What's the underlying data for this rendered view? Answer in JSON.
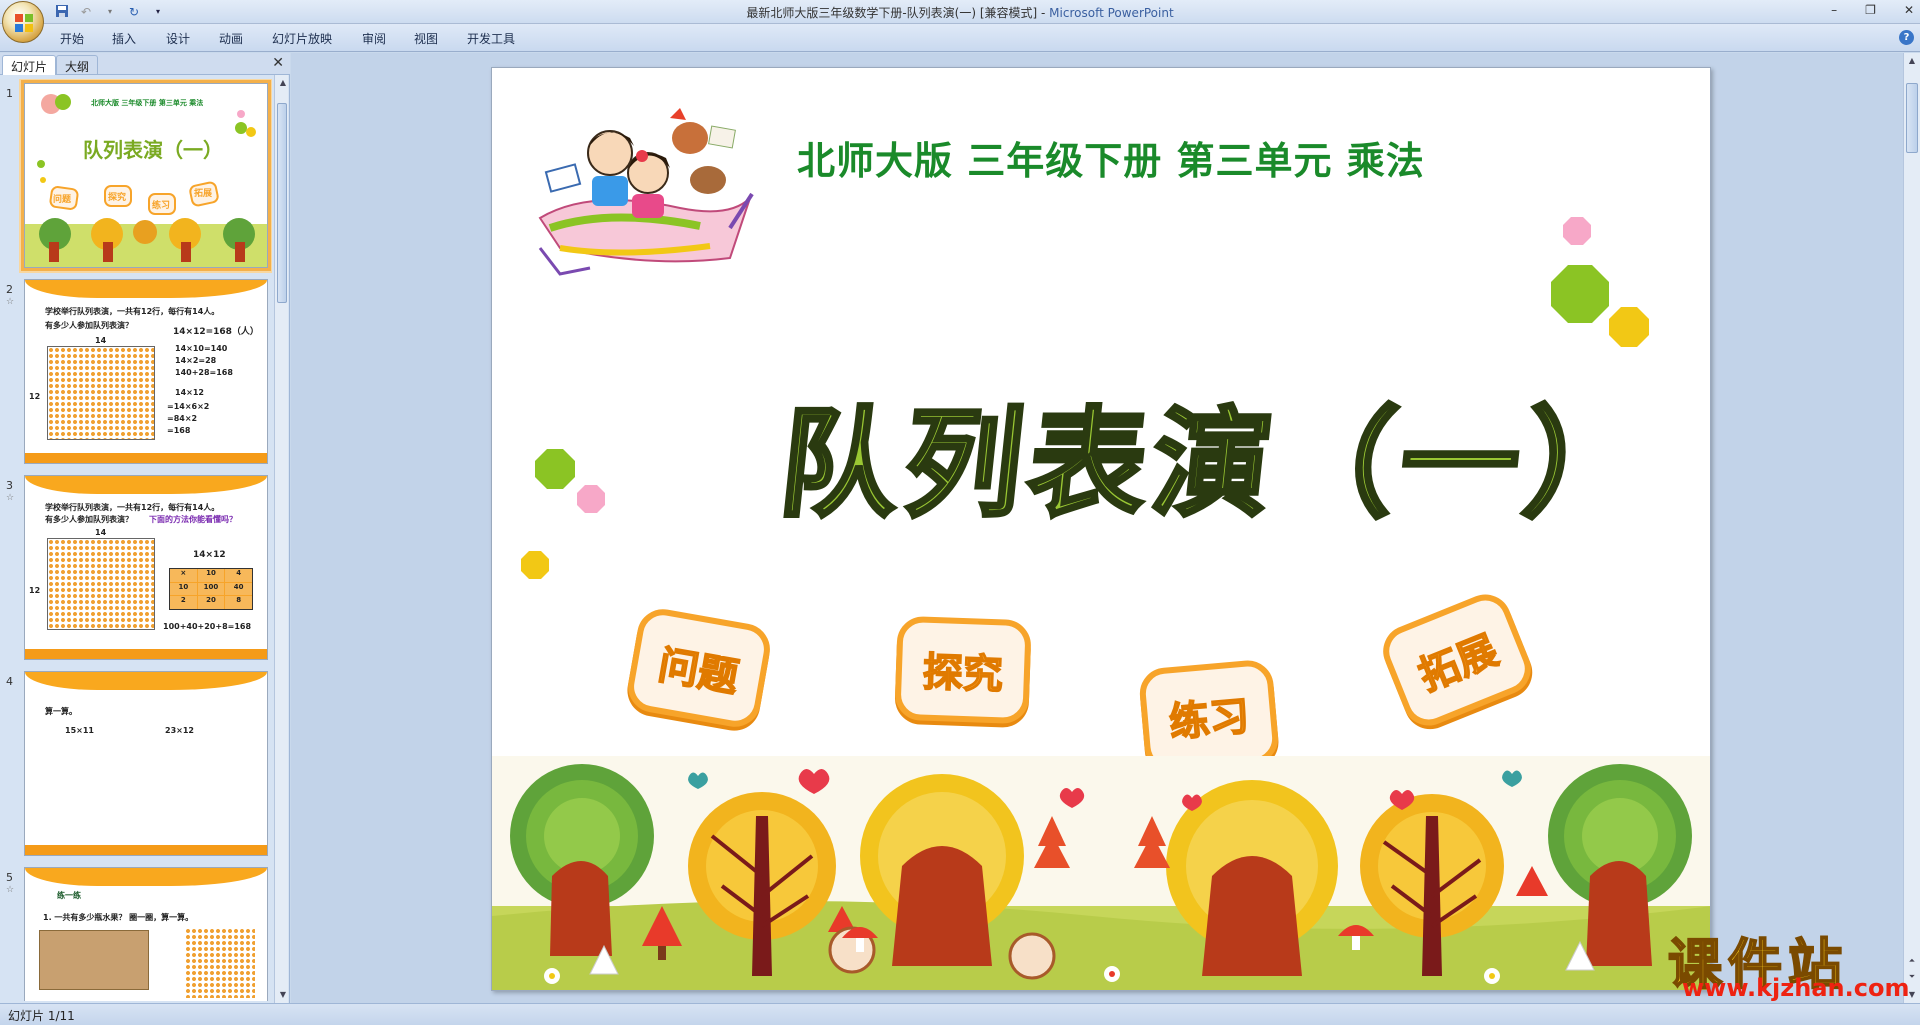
{
  "window": {
    "title_prefix": "最新北师大版三年级数学下册-队列表演(一) [兼容模式] - ",
    "app_name": "Microsoft PowerPoint"
  },
  "ribbon": {
    "tabs": [
      "开始",
      "插入",
      "设计",
      "动画",
      "幻灯片放映",
      "审阅",
      "视图",
      "开发工具"
    ]
  },
  "left_pane": {
    "tabs": [
      "幻灯片",
      "大纲"
    ]
  },
  "thumbnails": [
    {
      "number": "1",
      "title": "队列表演（一）",
      "subtitle": "北师大版 三年级下册 第三单元 乘法",
      "badges": [
        "问题",
        "探究",
        "练习",
        "拓展"
      ]
    },
    {
      "number": "2",
      "line1": "学校举行队列表演，一共有12行，每行有14人。",
      "line2": "有多少人参加队列表演？",
      "equation": "14×12=168（人）",
      "top_label": "14",
      "side_label": "12",
      "steps": [
        "14×10=140",
        "14×2=28",
        "140+28=168",
        "14×12",
        "=14×6×2",
        "=84×2",
        "=168"
      ]
    },
    {
      "number": "3",
      "line1": "学校举行队列表演，一共有12行，每行有14人。",
      "line2": "有多少人参加队列表演？",
      "line2_extra": "下面的方法你能看懂吗？",
      "top_label": "14",
      "side_label": "12",
      "equation": "14×12",
      "table": [
        [
          "×",
          "10",
          "4"
        ],
        [
          "10",
          "100",
          "40"
        ],
        [
          "2",
          "20",
          "8"
        ]
      ],
      "sum": "100+40+20+8=168"
    },
    {
      "number": "4",
      "line1": "算一算。",
      "exprs": [
        "15×11",
        "23×12"
      ]
    },
    {
      "number": "5",
      "heading": "练一练",
      "line1": "1. 一共有多少瓶水果？ 圈一圈，算一算。"
    }
  ],
  "slide": {
    "subtitle": "北师大版  三年级下册  第三单元  乘法",
    "title": "队列表演（一）",
    "badges": [
      "问题",
      "探究",
      "练习",
      "拓展"
    ]
  },
  "colors": {
    "subtitle": "#1a8a2a",
    "title": "#9ac733",
    "badge_orange": "#f7a42a",
    "green_poly": "#8bc424",
    "pink_poly": "#f7a8c8",
    "yellow_poly": "#f2c815"
  },
  "status": {
    "slide_indicator": "幻灯片 1/11"
  },
  "watermark": {
    "text": "课件站",
    "url": "www.kjzhan.com"
  }
}
